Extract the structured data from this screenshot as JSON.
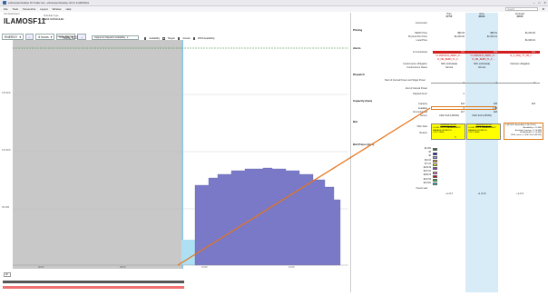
{
  "window": {
    "title": "ezForecast Desktop SV Trader Lite - ezForecast Desktop v10.3 | ILAMOSF11",
    "controls": [
      "–",
      "□",
      "✕"
    ]
  },
  "menu": {
    "items": [
      "File",
      "Tools",
      "Screenshot",
      "Layout",
      "Window",
      "Help"
    ],
    "search_placeholder": "Search"
  },
  "unit": {
    "duid_small": "Unit Dashboard",
    "duid": "ILAMOSF11",
    "schedule_type_label": "Schedule Type",
    "schedule_type_value": "SEMI-SCHEDULED"
  },
  "controls": {
    "view_select": "ENERGY",
    "back_range": "6 hours",
    "fwd_range": "6 hours",
    "bid_volumes_label": "Display Bid Volumes",
    "bid_volumes_value": "Capped at Dispatch Availability",
    "overlay_label": "Overlay Series",
    "overlay_items": [
      "Availability",
      "Targets",
      "Actuals",
      "PASA Availability"
    ]
  },
  "chart": {
    "y_ticks": [
      "150 MW",
      "100 MW",
      "50 MW"
    ],
    "x_ticks": [
      "06:00",
      "08:00",
      "10:00",
      "12:00"
    ],
    "zoom": "All"
  },
  "panel": {
    "col_headers": [
      {
        "label": "Prev",
        "time": "07:55"
      },
      {
        "label": "Now",
        "time": "08:00"
      },
      {
        "label": "Forecast",
        "time": "08:05"
      }
    ],
    "intervention_label": "Intervention",
    "pricing": {
      "title": "Pricing",
      "rows": [
        {
          "label": "NEMO Price",
          "vals": [
            "$96.94",
            "$95.51",
            "$1,000.00"
          ]
        },
        {
          "label": "Physical Run Price",
          "vals": [
            "$1,000.00",
            "$1,000.01",
            ""
          ]
        },
        {
          "label": "Local Price",
          "vals": [
            "",
            "",
            "$1,000.01"
          ]
        }
      ]
    },
    "alerts": {
      "title": "Alerts",
      "constrained_label": "Is Constrained",
      "constrained_vals": [
        "Yes",
        "Yes",
        "Yes"
      ],
      "constraint_rows": [
        {
          "vals": [
            "N::LMOSF11_ZERO_N ...",
            "N::LMOSF11_ZERO_N ...",
            "N_X_FRQ_TT_FB_T..."
          ]
        },
        {
          "vals": [
            "N_NR_ZERO_TL_F ...",
            "N_NR_ZERO_TL_F ...",
            ""
          ]
        }
      ],
      "conformance_label": "Conformance Obligation",
      "conformance_vals": [
        "SDC (individual)",
        "SDC (individual)",
        "Unknown obligation"
      ],
      "status_label": "Conformance Status",
      "status_vals": [
        "Normal",
        "Normal",
        ""
      ]
    },
    "dispatch": {
      "title": "Dispatch",
      "start_label": "Start of Interval Power and Target Power",
      "end_label": "End of Interval Power",
      "error_label": "Dispatch Error",
      "start_vals": [
        "0",
        "0",
        "0"
      ],
      "error_vals": [
        "0",
        "",
        ""
      ]
    },
    "capacity": {
      "title": "Capacity (Gen)",
      "rows": [
        {
          "label": "Capacity",
          "vals": [
            "216",
            "208",
            "203"
          ]
        },
        {
          "label": "Available",
          "vals": [
            "0",
            "1.05",
            ""
          ]
        },
        {
          "label": "Unconstrained",
          "vals": [
            "217",
            "208",
            ""
          ]
        },
        {
          "label": "Source",
          "vals": [
            "UIGF Self (LMOSF)",
            "UIGF Self (LMOSF)",
            ""
          ]
        }
      ]
    },
    "bid": {
      "title": "Bid",
      "offer_label": "Offer Date",
      "reason_label": "Reason",
      "offer_date_prev": "04/06/2023 07:49",
      "offer_date_now": "04/06/2023 07:54",
      "reason_prev": [
        "LOCAL PRICE MANAGEMENT",
        "MANAGE DISPATCH OUTCOMES"
      ],
      "reason_now": [
        "LOCAL PRICE MANAGEMENT",
        "MANAGE DISPATCH OUTCOMES"
      ],
      "rebid_count": "5",
      "tooltip": [
        "ILMOSF11 Availability 2.30 (03:50)",
        "Availability = 1.0 MW",
        "Available Capacity = 1.05 MW",
        "Bid Available = 1.05 MW",
        "UIGF source = UIGF Self (LMOSF)"
      ]
    },
    "bid_prices": {
      "title": "Bid Prices (Gen)",
      "bands": [
        {
          "price": "-$1,000",
          "color": "#1f7a1f"
        },
        {
          "price": "$0",
          "color": "#0000cc"
        },
        {
          "price": "$0",
          "color": "#7fa6d9"
        },
        {
          "price": "$32.00",
          "color": "#ff9c1a"
        },
        {
          "price": "$77.00",
          "color": "#ffff00"
        },
        {
          "price": "$129.39",
          "color": "#8a2be2"
        },
        {
          "price": "$197.00",
          "color": "#ff66cc"
        },
        {
          "price": "$299.29",
          "color": "#cc0000"
        },
        {
          "price": "$404.56",
          "color": "#00cc00"
        },
        {
          "price": "$15,500",
          "color": "#00cccc"
        }
      ],
      "fixed_load_label": "Fixed Load",
      "footer_vals": [
        "+1 of 3",
        "+1 of 10",
        "+1 of 3"
      ]
    }
  },
  "colors": {
    "bid_volume_fill": "#7a79c7",
    "available_fill": "#aedff2",
    "annotation_line": "#e8741a",
    "alert_red": "#d21d1d",
    "highlight_yellow": "#ffff00"
  }
}
